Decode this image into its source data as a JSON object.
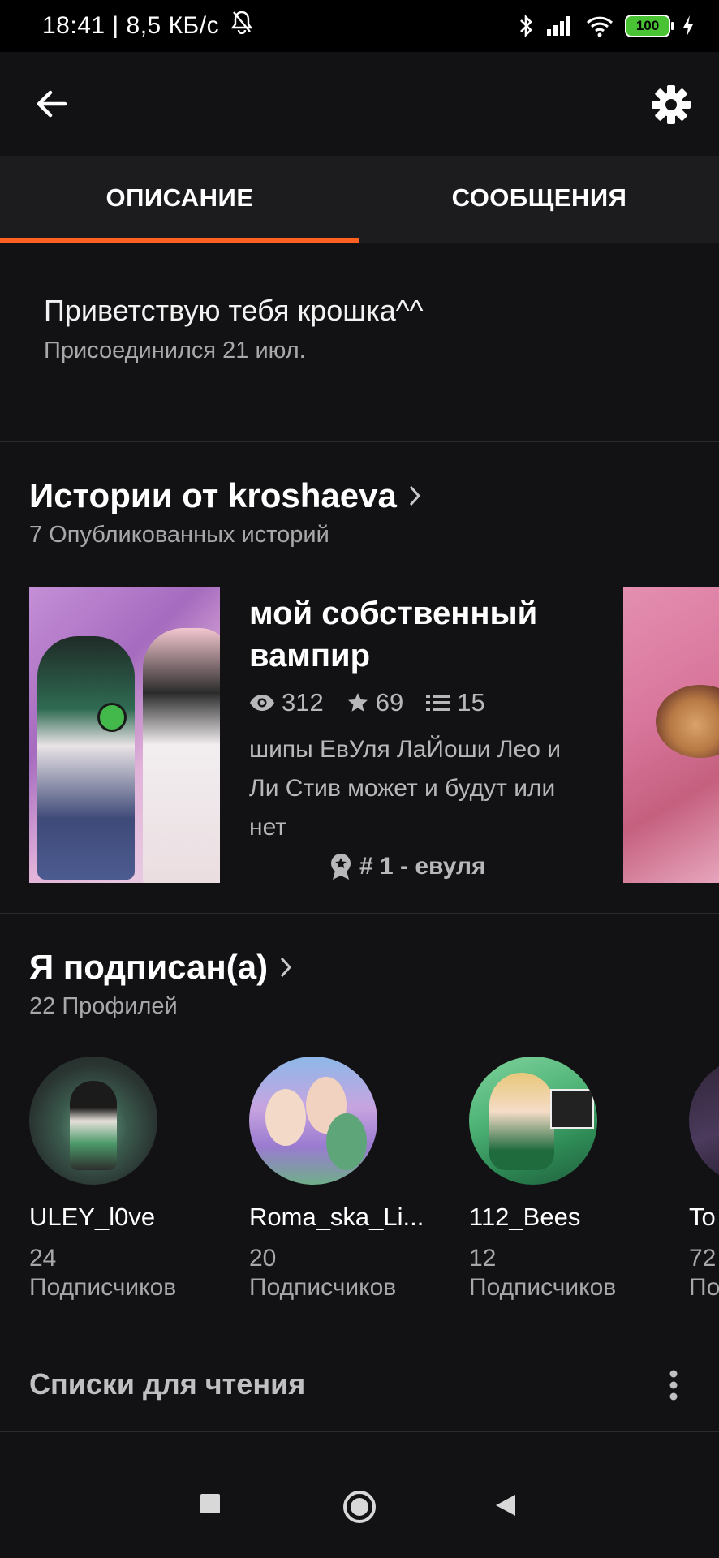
{
  "status_bar": {
    "time_speed": "18:41 | 8,5 КБ/с",
    "battery": "100"
  },
  "tabs": [
    {
      "label": "ОПИСАНИЕ",
      "active": true
    },
    {
      "label": "СООБЩЕНИЯ",
      "active": false
    }
  ],
  "profile": {
    "description": "Приветствую тебя крошка^^",
    "joined": "Присоединился 21 июл."
  },
  "stories_section": {
    "title": "Истории от kroshaeva",
    "subtitle": "7 Опубликованных историй",
    "story": {
      "title": "мой собственный вампир",
      "views": "312",
      "votes": "69",
      "parts": "15",
      "description": "шипы ЕвУля ЛаЙоши Лео и Ли Стив может и будут или нет",
      "rank": "# 1 - евуля"
    }
  },
  "following_section": {
    "title": "Я подписан(а)",
    "subtitle": "22 Профилей",
    "profiles": [
      {
        "name": "ULEY_l0ve",
        "count": "24",
        "label": "Подписчиков"
      },
      {
        "name": "Roma_ska_Li...",
        "count": "20",
        "label": "Подписчиков"
      },
      {
        "name": "112_Bees",
        "count": "12",
        "label": "Подписчиков"
      },
      {
        "name": "To",
        "count": "72",
        "label": "По"
      }
    ]
  },
  "reading_lists": {
    "title": "Списки для чтения"
  },
  "colors": {
    "accent": "#ff6122",
    "background": "#121214",
    "tab_bar": "#1c1c1e",
    "secondary_text": "#a8a8ab"
  },
  "icons": [
    "back-arrow-icon",
    "gear-icon",
    "eye-icon",
    "star-icon",
    "list-icon",
    "medal-icon",
    "chevron-right-icon",
    "more-vert-icon",
    "bell-off-icon",
    "bluetooth-icon",
    "signal-icon",
    "wifi-icon",
    "charging-icon",
    "nav-square-icon",
    "nav-circle-icon",
    "nav-back-icon"
  ]
}
